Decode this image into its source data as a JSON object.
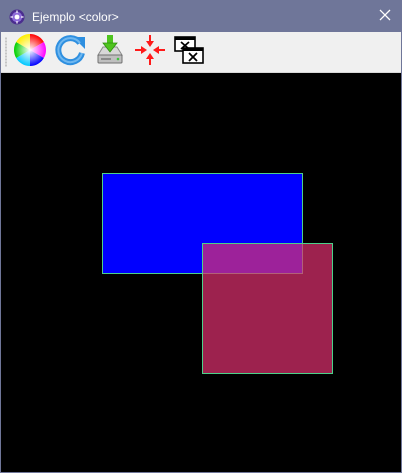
{
  "window": {
    "title": "Ejemplo <color>",
    "app_icon": "gear-icon",
    "close_icon": "close-icon"
  },
  "toolbar": {
    "buttons": [
      {
        "name": "color-wheel-button",
        "icon": "color-wheel-icon"
      },
      {
        "name": "refresh-button",
        "icon": "refresh-icon"
      },
      {
        "name": "save-button",
        "icon": "save-download-icon"
      },
      {
        "name": "center-button",
        "icon": "arrows-inward-icon"
      },
      {
        "name": "clear-button",
        "icon": "close-windows-icon"
      }
    ]
  },
  "canvas": {
    "background": "#000000",
    "shapes": [
      {
        "name": "blue-rectangle",
        "fill": "#0000ff",
        "outline": "#4cd18a"
      },
      {
        "name": "translucent-red-square",
        "fill": "#e0306f",
        "opacity": 0.7,
        "outline": "#4cd18a"
      }
    ]
  },
  "colors": {
    "titlebar": "#6f7699",
    "toolbar": "#f0f0f0"
  }
}
